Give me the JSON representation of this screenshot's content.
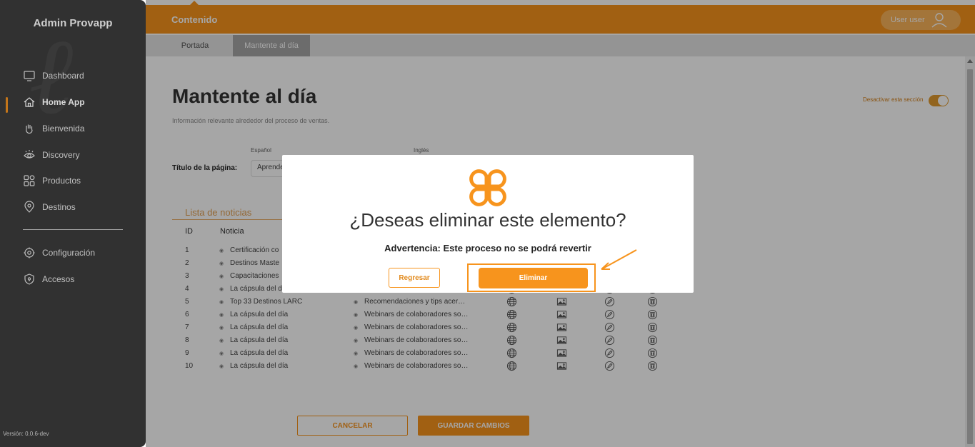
{
  "sidebar": {
    "brand": "Admin Provapp",
    "items": [
      {
        "label": "Dashboard",
        "icon": "monitor-icon"
      },
      {
        "label": "Home App",
        "icon": "home-icon",
        "active": true
      },
      {
        "label": "Bienvenida",
        "icon": "hand-wave-icon"
      },
      {
        "label": "Discovery",
        "icon": "eye-icon"
      },
      {
        "label": "Productos",
        "icon": "grid-icon"
      },
      {
        "label": "Destinos",
        "icon": "map-pin-icon"
      },
      {
        "label": "Configuración",
        "icon": "gear-icon"
      },
      {
        "label": "Accesos",
        "icon": "shield-icon"
      }
    ],
    "version": "Versión: 0.0.6-dev"
  },
  "header": {
    "section": "Contenido",
    "user": "User user"
  },
  "tabs": [
    {
      "label": "Portada"
    },
    {
      "label": "Mantente al día",
      "active": true
    }
  ],
  "page": {
    "title": "Mantente al día",
    "subtitle": "Información relevante alrededor del proceso de ventas.",
    "toggle_label": "Desactivar esta sección",
    "toggle_on": true,
    "lang_es": "Español",
    "lang_en": "Inglés",
    "field_label": "Título de la página:",
    "field_value": "Aprende",
    "list_title": "Lista de noticias",
    "col_id": "ID",
    "col_news": "Noticia"
  },
  "rows": [
    {
      "id": "1",
      "title": "Certificación co",
      "desc": ""
    },
    {
      "id": "2",
      "title": "Destinos Maste",
      "desc": ""
    },
    {
      "id": "3",
      "title": "Capacitaciones",
      "desc": ""
    },
    {
      "id": "4",
      "title": "La cápsula del d",
      "desc": ""
    },
    {
      "id": "5",
      "title": "Top 33 Destinos LARC",
      "desc": "Recomendaciones y tips acer…"
    },
    {
      "id": "6",
      "title": "La cápsula del día",
      "desc": "Webinars de colaboradores so…"
    },
    {
      "id": "7",
      "title": "La cápsula del día",
      "desc": "Webinars de colaboradores so…"
    },
    {
      "id": "8",
      "title": "La cápsula del día",
      "desc": "Webinars de colaboradores so…"
    },
    {
      "id": "9",
      "title": "La cápsula del día",
      "desc": "Webinars de colaboradores so…"
    },
    {
      "id": "10",
      "title": "La cápsula del día",
      "desc": "Webinars de colaboradores so…"
    }
  ],
  "actions": {
    "cancel": "CANCELAR",
    "save": "GUARDAR CAMBIOS"
  },
  "modal": {
    "title": "¿Deseas eliminar este elemento?",
    "warning": "Advertencia: Este proceso no se podrá revertir",
    "back": "Regresar",
    "delete": "Eliminar"
  },
  "colors": {
    "accent": "#f7941d",
    "sidebar_bg": "#3a3a3a"
  }
}
